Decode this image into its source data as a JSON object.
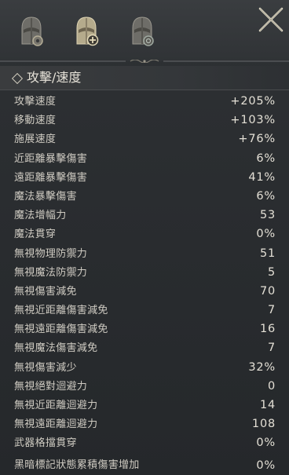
{
  "tabs": [
    {
      "icon": "helmet-gear-icon"
    },
    {
      "icon": "helmet-plus-icon"
    },
    {
      "icon": "helmet-shield-icon"
    }
  ],
  "close_icon": "close-x-icon",
  "section": {
    "title": "攻擊/速度",
    "icon": "diamond-icon"
  },
  "stats": [
    {
      "label": "攻擊速度",
      "value": "+205%"
    },
    {
      "label": "移動速度",
      "value": "+103%"
    },
    {
      "label": "施展速度",
      "value": "+76%"
    },
    {
      "label": "近距離暴擊傷害",
      "value": "6%"
    },
    {
      "label": "遠距離暴擊傷害",
      "value": "41%"
    },
    {
      "label": "魔法暴擊傷害",
      "value": "6%"
    },
    {
      "label": "魔法增幅力",
      "value": "53"
    },
    {
      "label": "魔法貫穿",
      "value": "0%"
    },
    {
      "label": "無視物理防禦力",
      "value": "51"
    },
    {
      "label": "無視魔法防禦力",
      "value": "5"
    },
    {
      "label": "無視傷害減免",
      "value": "70"
    },
    {
      "label": "無視近距離傷害減免",
      "value": "7"
    },
    {
      "label": "無視遠距離傷害減免",
      "value": "16"
    },
    {
      "label": "無視魔法傷害減免",
      "value": "7"
    },
    {
      "label": "無視傷害減少",
      "value": "32%"
    },
    {
      "label": "無視絕對迴避力",
      "value": "0"
    },
    {
      "label": "無視近距離迴避力",
      "value": "14"
    },
    {
      "label": "無視遠距離迴避力",
      "value": "108"
    },
    {
      "label": "武器格擋貫穿",
      "value": "0%"
    },
    {
      "label": "黑暗標記狀態累積傷害增加",
      "value": "0%"
    }
  ],
  "colors": {
    "background": "#26292c",
    "text": "#cfcbc2",
    "accent": "#c8c2a8"
  }
}
